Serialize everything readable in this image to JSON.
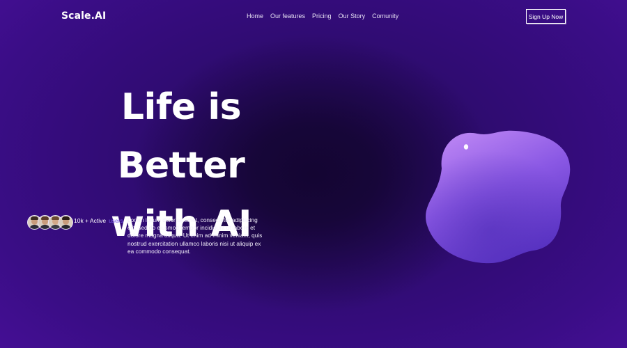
{
  "nav": {
    "logo": "Scale.AI",
    "links": [
      "Home",
      "Our features",
      "Pricing",
      "Our Story",
      "Comunity"
    ],
    "signup_label": "Sign Up Now"
  },
  "hero": {
    "line1": "Life is Better",
    "line2": "with AI"
  },
  "social": {
    "count_text": "10k + Active",
    "accent_text": "users",
    "avatar_count": 4
  },
  "description": "Lorem ipsum dolor sit amet, consectetur adipiscing elit, sed do eiusmod tempor incididunt ut labore et dolore magna aliqua. Ut enim ad minim veniam, quis nostrud exercitation ullamco laboris nisi ut aliquip ex ea commodo consequat.",
  "colors": {
    "background": "#2a0b6a",
    "accent": "#7d5cf0",
    "blob_light": "#b27ef0",
    "blob_dark": "#5b34c6"
  }
}
